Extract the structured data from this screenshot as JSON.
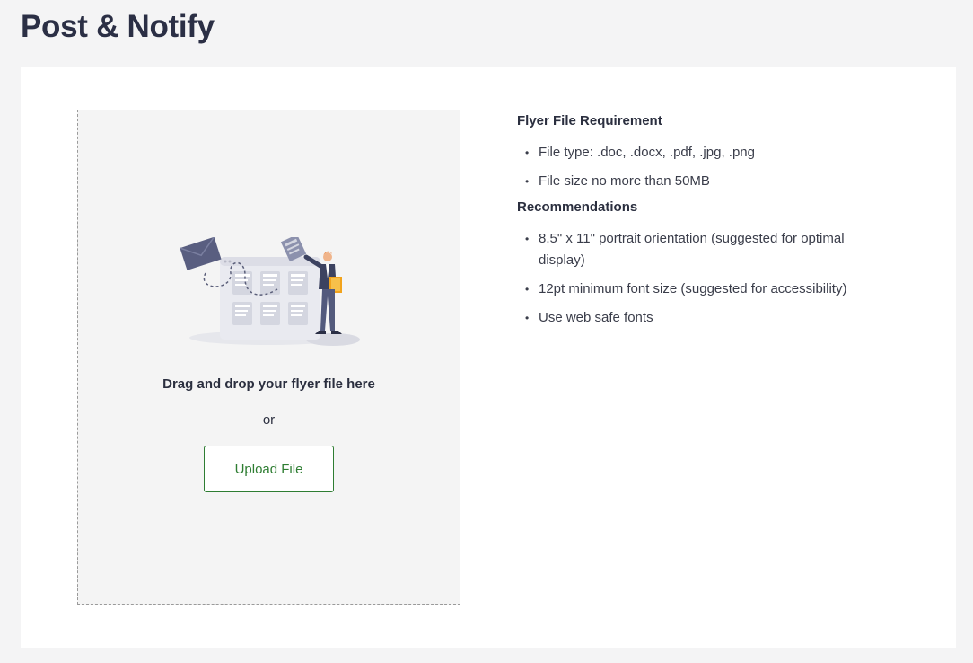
{
  "page": {
    "title": "Post & Notify"
  },
  "upload": {
    "drop_text": "Drag and drop your flyer file here",
    "or_text": "or",
    "button_label": "Upload File",
    "illustration_icon": "upload-flyer-illustration"
  },
  "requirements": {
    "heading": "Flyer File Requirement",
    "items": [
      "File type: .doc, .docx, .pdf, .jpg, .png",
      "File size no more than 50MB"
    ]
  },
  "recommendations": {
    "heading": "Recommendations",
    "items": [
      "8.5\" x 11\" portrait orientation (suggested for optimal display)",
      "12pt minimum font size (suggested for accessibility)",
      "Use web safe fonts"
    ]
  },
  "colors": {
    "accent_green": "#2e7d32",
    "page_background": "#f4f4f5",
    "dropzone_background": "#f4f4f4"
  }
}
